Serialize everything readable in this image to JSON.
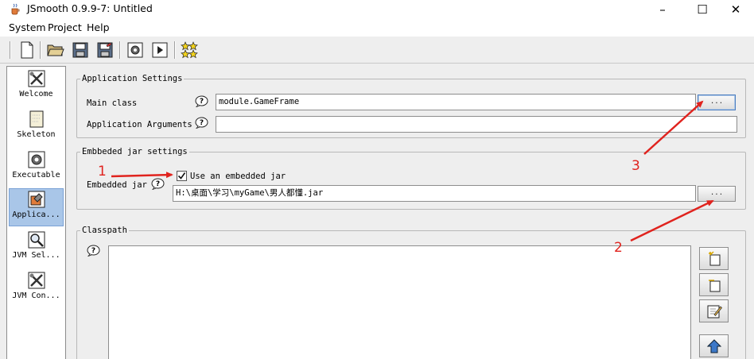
{
  "window": {
    "title": "JSmooth 0.9.9-7: Untitled",
    "icon": "java-cup-icon"
  },
  "window_controls": {
    "minimize": "–",
    "maximize": "☐",
    "close": "✕"
  },
  "menu": [
    "System",
    "Project",
    "Help"
  ],
  "toolbar": [
    "new-file-icon",
    "open-folder-icon",
    "save-icon",
    "save-as-icon",
    "compile-gear-icon",
    "run-icon",
    "stars-icon"
  ],
  "sidebar": {
    "items": [
      {
        "label": "Welcome",
        "icon": "tools-icon",
        "selected": false
      },
      {
        "label": "Skeleton",
        "icon": "page-icon",
        "selected": false
      },
      {
        "label": "Executable",
        "icon": "gear-icon",
        "selected": false
      },
      {
        "label": "Applica...",
        "icon": "application-icon",
        "selected": true
      },
      {
        "label": "JVM Sel...",
        "icon": "magnifier-icon",
        "selected": false
      },
      {
        "label": "JVM Con...",
        "icon": "tools-icon",
        "selected": false
      }
    ]
  },
  "app_settings": {
    "title": "Application Settings",
    "main_class_label": "Main class",
    "main_class_value": "module.GameFrame",
    "arguments_label": "Application Arguments",
    "arguments_value": "",
    "browse_label": "..."
  },
  "embedded_jar": {
    "title": "Embbeded jar settings",
    "checkbox_label": "Use an embedded jar",
    "checked": true,
    "jar_label": "Embedded jar",
    "jar_value": "H:\\桌面\\学习\\myGame\\男人都懂.jar",
    "browse_label": "..."
  },
  "classpath": {
    "title": "Classpath",
    "buttons": [
      "add-item-icon",
      "add-folder-icon",
      "edit-icon",
      "move-up-icon"
    ]
  },
  "annotations": {
    "num1": "1",
    "num2": "2",
    "num3": "3",
    "color": "#e0231e"
  }
}
